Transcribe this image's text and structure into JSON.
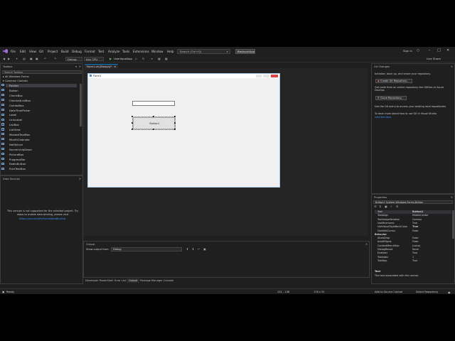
{
  "menu": {
    "items": [
      "File",
      "Edit",
      "View",
      "Git",
      "Project",
      "Build",
      "Debug",
      "Format",
      "Test",
      "Analyze",
      "Tools",
      "Extensions",
      "Window",
      "Help"
    ]
  },
  "search": {
    "placeholder": "Search (Ctrl+Q)"
  },
  "solution_badge": "BasInputApp",
  "signin": "Sign in",
  "live_share": "Live Share",
  "toolbar": {
    "config": "Debug",
    "platform": "Any CPU",
    "run_label": "UserInputApp"
  },
  "document_tab": "Form1.vb [Design]*",
  "toolbox": {
    "title": "Toolbox",
    "search_placeholder": "Search Toolbox",
    "group_all": "All Windows Forms",
    "group_common": "Common Controls",
    "items": [
      "Pointer",
      "Button",
      "CheckBox",
      "CheckedListBox",
      "ComboBox",
      "DateTimePicker",
      "Label",
      "LinkLabel",
      "ListBox",
      "ListView",
      "MaskedTextBox",
      "MonthCalendar",
      "NotifyIcon",
      "NumericUpDown",
      "PictureBox",
      "ProgressBar",
      "RadioButton",
      "RichTextBox"
    ]
  },
  "data_sources": {
    "title": "Data Sources",
    "message": "This version is not supported for the selected project. Try steps to enable data binding, please visit",
    "link": "https://aka.ms/WinFormsDataBinding"
  },
  "form": {
    "title": "Form1",
    "button_label": "Button1"
  },
  "git_changes": {
    "title": "Git Changes",
    "intro": "Initialize, back up, and share your repository.",
    "create_button": "Create Git Repository...",
    "clone_intro": "Get code from an online repository like GitHub or Azure DevOps",
    "clone_button": "Clone Repository...",
    "menu_hint": "Use the Git menu to access your existing local repositories.",
    "learn": "To learn more about how to use Git in Visual Studio",
    "read_docs": "read the docs"
  },
  "properties": {
    "title": "Properties",
    "object": "Button1  System.Windows.Forms.Button",
    "rows": [
      {
        "name": "Text",
        "value": "Button1",
        "bold": true
      },
      {
        "name": "TextAlign",
        "value": "MiddleCenter"
      },
      {
        "name": "TextImageRelation",
        "value": "Overlay"
      },
      {
        "name": "UseMnemonic",
        "value": "True"
      },
      {
        "name": "UseVisualStyleBackColor",
        "value": "True",
        "bold": true
      },
      {
        "name": "UseWaitCursor",
        "value": "False"
      },
      {
        "name": "Behavior",
        "value": "",
        "category": true
      },
      {
        "name": "AllowDrop",
        "value": "False"
      },
      {
        "name": "AutoEllipsis",
        "value": "False"
      },
      {
        "name": "ContextMenuStrip",
        "value": "(none)"
      },
      {
        "name": "DialogResult",
        "value": "None"
      },
      {
        "name": "Enabled",
        "value": "True"
      },
      {
        "name": "TabIndex",
        "value": "1"
      },
      {
        "name": "TabStop",
        "value": "True"
      }
    ],
    "desc_title": "Text",
    "desc_text": "The text associated with the control."
  },
  "output": {
    "title": "Output",
    "show_from_label": "Show output from:",
    "show_from_value": "Debug"
  },
  "bottom_tabs": [
    "Developer PowerShell",
    "Error List",
    "Output",
    "Package Manager Console"
  ],
  "status": {
    "ready": "Ready",
    "position": "132 , 136",
    "size": "178 x 51",
    "add_source": "Add to Source Control",
    "select_repo": "Select Repository"
  },
  "colors": {
    "accent": "#007acc",
    "status_bar": "#1f1f1f",
    "git_button": "#2d2d30",
    "link": "#3794ff"
  }
}
